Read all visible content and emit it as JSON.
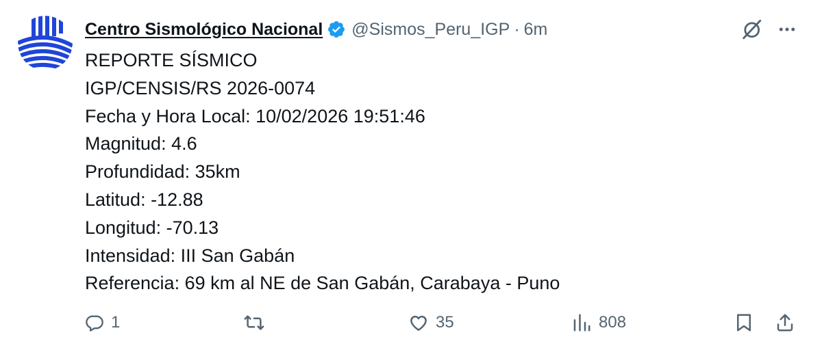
{
  "header": {
    "display_name": "Centro Sismológico Nacional",
    "handle": "@Sismos_Peru_IGP",
    "separator": "·",
    "timestamp": "6m"
  },
  "body": {
    "lines": [
      "REPORTE SÍSMICO",
      "IGP/CENSIS/RS 2026-0074",
      "Fecha y Hora Local: 10/02/2026 19:51:46",
      "Magnitud: 4.6",
      "Profundidad: 35km",
      "Latitud: -12.88",
      "Longitud: -70.13",
      "Intensidad: III San Gabán",
      "Referencia: 69 km al NE de San Gabán, Carabaya - Puno"
    ]
  },
  "actions": {
    "reply_count": "1",
    "repost_count": "",
    "like_count": "35",
    "views_count": "808"
  },
  "icons": {
    "verified": "verified-badge-icon",
    "grok": "grok-icon",
    "more": "more-icon",
    "reply": "reply-icon",
    "repost": "repost-icon",
    "like": "heart-icon",
    "views": "views-icon",
    "bookmark": "bookmark-icon",
    "share": "share-icon"
  },
  "colors": {
    "text": "#0f1419",
    "secondary": "#536471",
    "verified": "#1d9bf0",
    "avatar_blue": "#1f45d8"
  }
}
